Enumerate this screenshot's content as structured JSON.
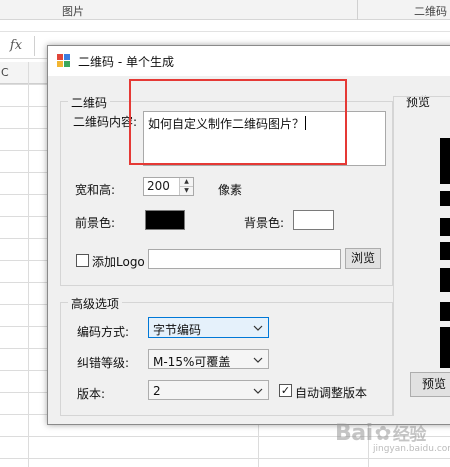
{
  "spreadsheet": {
    "ribbon_labels": [
      "图片",
      "二维码"
    ],
    "formula_icon": "fx",
    "column_letter": "C"
  },
  "dialog": {
    "title": "二维码 - 单个生成",
    "qr_group": {
      "legend": "二维码",
      "content_label": "二维码内容:",
      "content_value": "如何自定义制作二维码图片？",
      "size_label": "宽和高:",
      "size_value": "200",
      "size_unit": "像素",
      "foreground_label": "前景色:",
      "foreground_color": "#000000",
      "background_label": "背景色:",
      "background_color": "#ffffff",
      "logo_label": "添加Logo",
      "logo_checked": false,
      "browse_label": "浏览"
    },
    "advanced_group": {
      "legend": "高级选项",
      "encoding_label": "编码方式:",
      "encoding_value": "字节编码",
      "ecc_label": "纠错等级:",
      "ecc_value": "M-15%可覆盖",
      "version_label": "版本:",
      "version_value": "2",
      "auto_version_label": "自动调整版本",
      "auto_version_checked": true
    },
    "preview": {
      "label": "预览",
      "button_label": "预览"
    }
  },
  "annotation": {
    "highlight_color": "#e53935"
  },
  "watermark": {
    "text": "Bai",
    "text2": "经验",
    "sub": "jingyan.baidu.com"
  }
}
